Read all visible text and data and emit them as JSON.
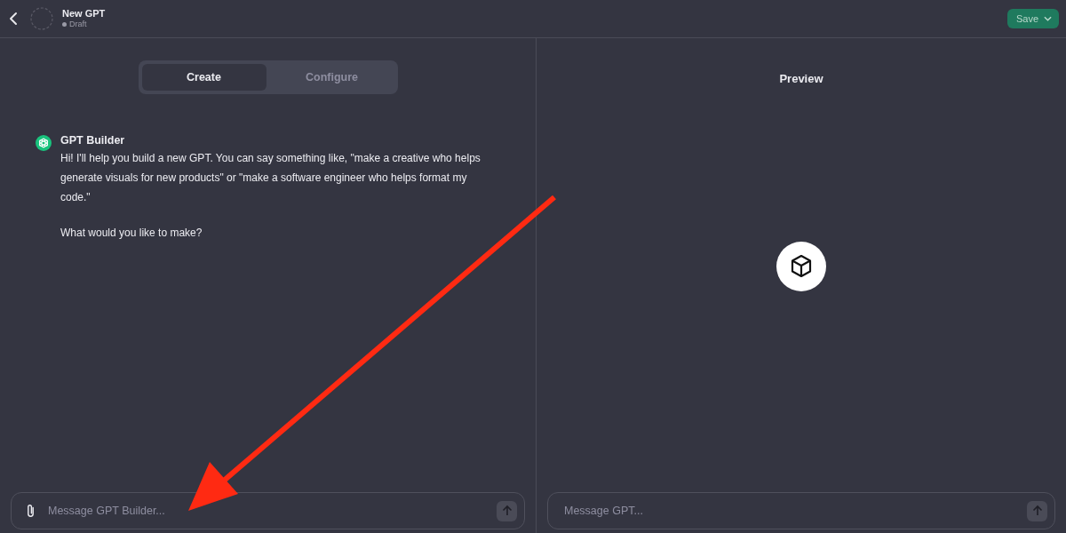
{
  "header": {
    "title": "New GPT",
    "status": "Draft",
    "save_button": "Save"
  },
  "tabs": [
    {
      "label": "Create",
      "selected": true
    },
    {
      "label": "Configure",
      "selected": false
    }
  ],
  "builder_message": {
    "sender": "GPT Builder",
    "paragraphs": [
      "Hi! I'll help you build a new GPT. You can say something like, \"make a creative who helps generate visuals for new products\" or \"make a software engineer who helps format my code.\"",
      "What would you like to make?"
    ]
  },
  "builder_input": {
    "placeholder": "Message GPT Builder..."
  },
  "preview": {
    "title": "Preview",
    "input": {
      "placeholder": "Message GPT..."
    }
  }
}
